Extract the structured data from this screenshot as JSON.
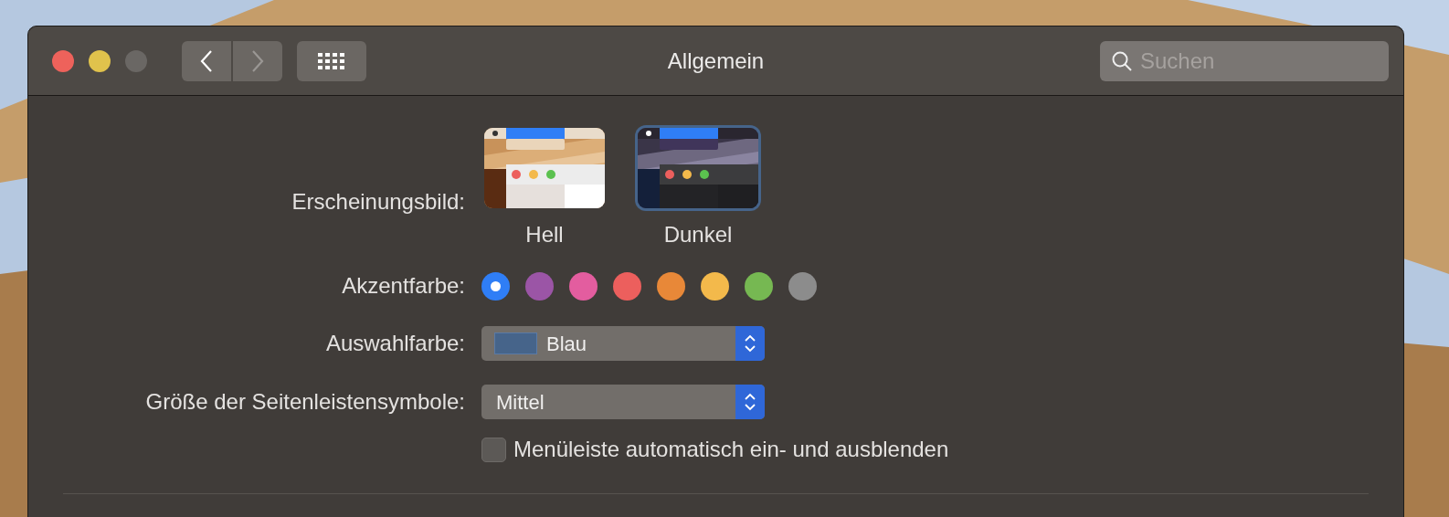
{
  "window": {
    "title": "Allgemein"
  },
  "search": {
    "placeholder": "Suchen"
  },
  "appearance": {
    "label": "Erscheinungsbild:",
    "options": [
      {
        "kind": "light",
        "label": "Hell",
        "selected": false
      },
      {
        "kind": "dark",
        "label": "Dunkel",
        "selected": true
      }
    ]
  },
  "accent": {
    "label": "Akzentfarbe:",
    "colors": [
      {
        "color": "#2f7ef6",
        "selected": true
      },
      {
        "color": "#9b55a6",
        "selected": false
      },
      {
        "color": "#e35d9f",
        "selected": false
      },
      {
        "color": "#ec5f5d",
        "selected": false
      },
      {
        "color": "#e88838",
        "selected": false
      },
      {
        "color": "#f3b94b",
        "selected": false
      },
      {
        "color": "#76b852",
        "selected": false
      },
      {
        "color": "#8c8c8c",
        "selected": false
      }
    ]
  },
  "highlight": {
    "label": "Auswahlfarbe:",
    "value": "Blau",
    "color": "#46648a"
  },
  "sidebar_icon_size": {
    "label": "Größe der Seitenleistensymbole:",
    "value": "Mittel"
  },
  "menu_bar_autohide": {
    "label": "Menüleiste automatisch ein- und ausblenden",
    "checked": false
  }
}
